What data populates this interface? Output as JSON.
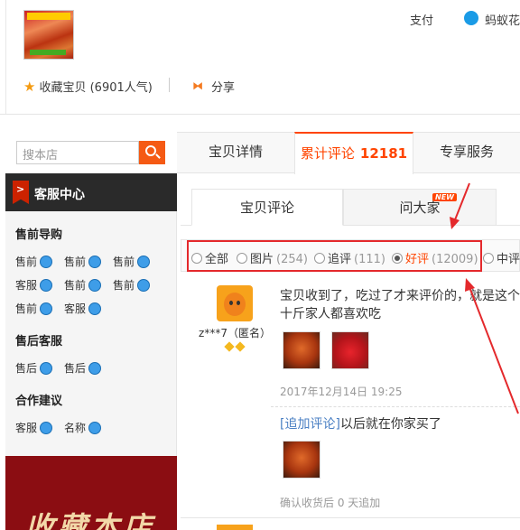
{
  "header": {
    "pay_label": "支付",
    "alipay_label": "蚂蚁花",
    "fav_label": "收藏宝贝",
    "fav_count": "(6901人气)",
    "share_label": "分享"
  },
  "sidebar": {
    "search_placeholder": "搜本店",
    "service_center": "客服中心",
    "service_badge": ">",
    "presale_title": "售前导购",
    "presale_items": [
      "售前",
      "售前",
      "售前",
      "客服",
      "售前",
      "售前",
      "售前",
      "客服"
    ],
    "aftersale_title": "售后客服",
    "aftersale_items": [
      "售后",
      "售后"
    ],
    "coop_title": "合作建议",
    "coop_items": [
      "客服",
      "名称"
    ],
    "banner_text": "收藏本店"
  },
  "tabs": {
    "detail": "宝贝详情",
    "reviews": "累计评论",
    "reviews_count": "12181",
    "exclusive": "专享服务"
  },
  "subtabs": {
    "item_reviews": "宝贝评论",
    "ask": "问大家",
    "new_badge": "NEW"
  },
  "filters": [
    {
      "label": "全部",
      "count": "",
      "selected": false
    },
    {
      "label": "图片",
      "count": "(254)",
      "selected": false
    },
    {
      "label": "追评",
      "count": "(111)",
      "selected": false
    },
    {
      "label": "好评",
      "count": "(12009)",
      "selected": true
    },
    {
      "label": "中评",
      "count": "",
      "selected": false
    }
  ],
  "review": {
    "user": "z***7（匿名）",
    "text": "宝贝收到了，吃过了才来评价的，就是这个十斤家人都喜欢吃",
    "date": "2017年12月14日 19:25",
    "followup_tag": "[追加评论]",
    "followup_text": "以后就在你家买了",
    "confirm_text": "确认收货后 0 天追加"
  },
  "colors": {
    "accent": "#ff4400",
    "annotation": "#e4292c"
  }
}
